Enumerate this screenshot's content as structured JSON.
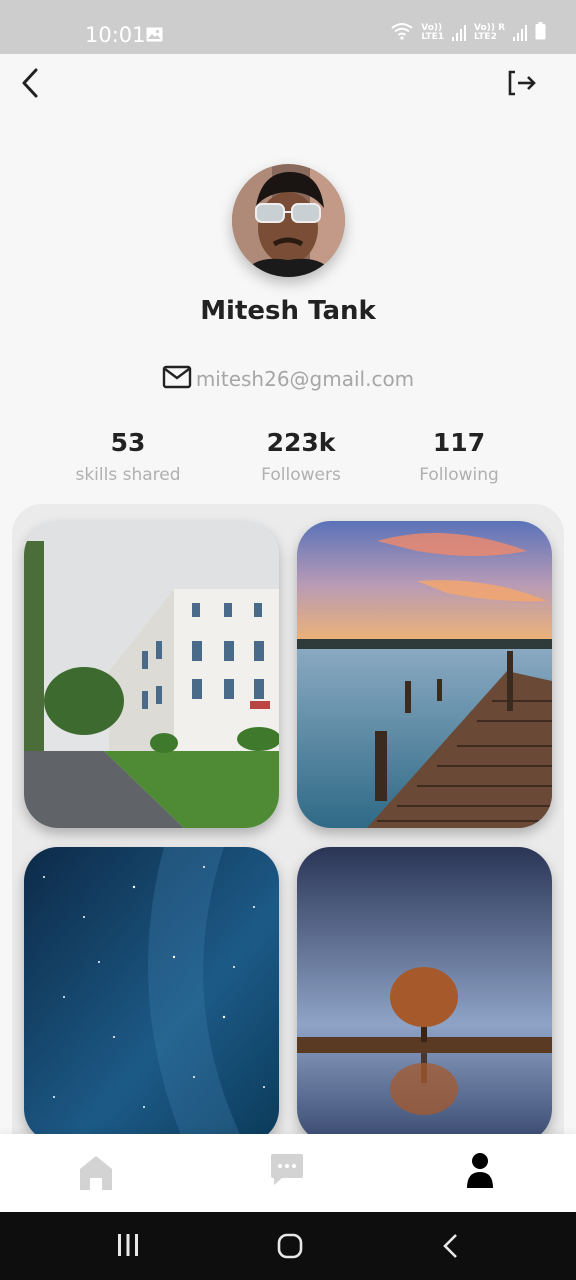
{
  "status_bar": {
    "time": "10:01",
    "sim1_top": "Vo))",
    "sim1_bottom": "LTE1",
    "sim2_top": "Vo)) R",
    "sim2_bottom": "LTE2",
    "icons": [
      "gallery-icon",
      "wifi-icon",
      "signal-icon",
      "battery-icon"
    ]
  },
  "header": {
    "back_icon": "back-arrow-icon",
    "logout_icon": "logout-icon"
  },
  "profile": {
    "name": "Mitesh Tank",
    "email": "mitesh26@gmail.com",
    "email_icon": "mail-icon"
  },
  "stats": [
    {
      "value": "53",
      "label": "skills shared"
    },
    {
      "value": "223k",
      "label": "Followers"
    },
    {
      "value": "117",
      "label": "Following"
    }
  ],
  "bottom_nav": {
    "items": [
      "home-icon",
      "chat-icon",
      "profile-icon"
    ],
    "active": "profile-icon",
    "active_color": "#000000",
    "inactive_color": "#d3d3d3"
  },
  "system_nav": [
    "recent-apps-icon",
    "home-circle-icon",
    "back-chevron-icon"
  ]
}
